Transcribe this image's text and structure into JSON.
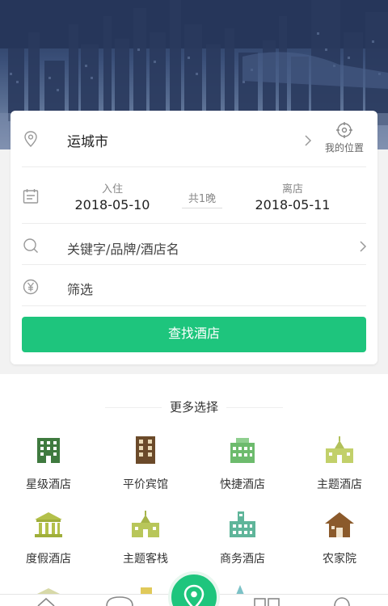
{
  "location": {
    "city": "运城市",
    "my_location_label": "我的位置"
  },
  "dates": {
    "checkin_label": "入住",
    "checkin_date": "2018-05-10",
    "nights_text": "共1晚",
    "checkout_label": "离店",
    "checkout_date": "2018-05-11"
  },
  "search": {
    "keyword_placeholder": "关键字/品牌/酒店名",
    "filter_label": "筛选",
    "button_label": "查找酒店"
  },
  "more": {
    "title": "更多选择",
    "categories": [
      {
        "label": "星级酒店",
        "icon": "star-hotel-icon",
        "color": "#3f7a3f"
      },
      {
        "label": "平价宾馆",
        "icon": "budget-hotel-icon",
        "color": "#6b4a2a"
      },
      {
        "label": "快捷酒店",
        "icon": "express-hotel-icon",
        "color": "#6dbb6d"
      },
      {
        "label": "主题酒店",
        "icon": "theme-hotel-icon",
        "color": "#c2d06a"
      },
      {
        "label": "度假酒店",
        "icon": "resort-hotel-icon",
        "color": "#b3c04a"
      },
      {
        "label": "主题客栈",
        "icon": "theme-inn-icon",
        "color": "#b8c65a"
      },
      {
        "label": "商务酒店",
        "icon": "business-hotel-icon",
        "color": "#5fb59a"
      },
      {
        "label": "农家院",
        "icon": "farmhouse-icon",
        "color": "#8b5a2b"
      }
    ]
  },
  "colors": {
    "accent": "#1ec57d"
  }
}
